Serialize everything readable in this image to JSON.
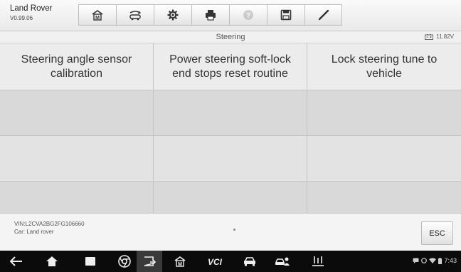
{
  "toolbar": {
    "brand_name": "Land Rover",
    "brand_version": "V0.99.06",
    "buttons": [
      {
        "icon": "home-icon",
        "enabled": true
      },
      {
        "icon": "vehicle-swap-icon",
        "enabled": true
      },
      {
        "icon": "settings-gear-icon",
        "enabled": true
      },
      {
        "icon": "print-icon",
        "enabled": true
      },
      {
        "icon": "help-icon",
        "enabled": false
      },
      {
        "icon": "save-icon",
        "enabled": true
      },
      {
        "icon": "pen-icon",
        "enabled": true
      }
    ]
  },
  "subheader": {
    "title": "Steering",
    "battery_voltage": "11.82V"
  },
  "grid": {
    "functions": [
      "Steering angle sensor calibration",
      "Power steering soft-lock end stops reset routine",
      "Lock steering tune to vehicle"
    ]
  },
  "footer": {
    "vin": "VIN:L2CVA2BG2FG106660",
    "car": "Car: Land rover",
    "esc_label": "ESC"
  },
  "navbar": {
    "clock": "7:43"
  },
  "colors": {
    "toolbar_bg": "#efefef",
    "grid_row_dark": "#d9d9d9",
    "grid_row_light": "#e3e3e3",
    "navbar_bg": "#0b0b0b"
  }
}
